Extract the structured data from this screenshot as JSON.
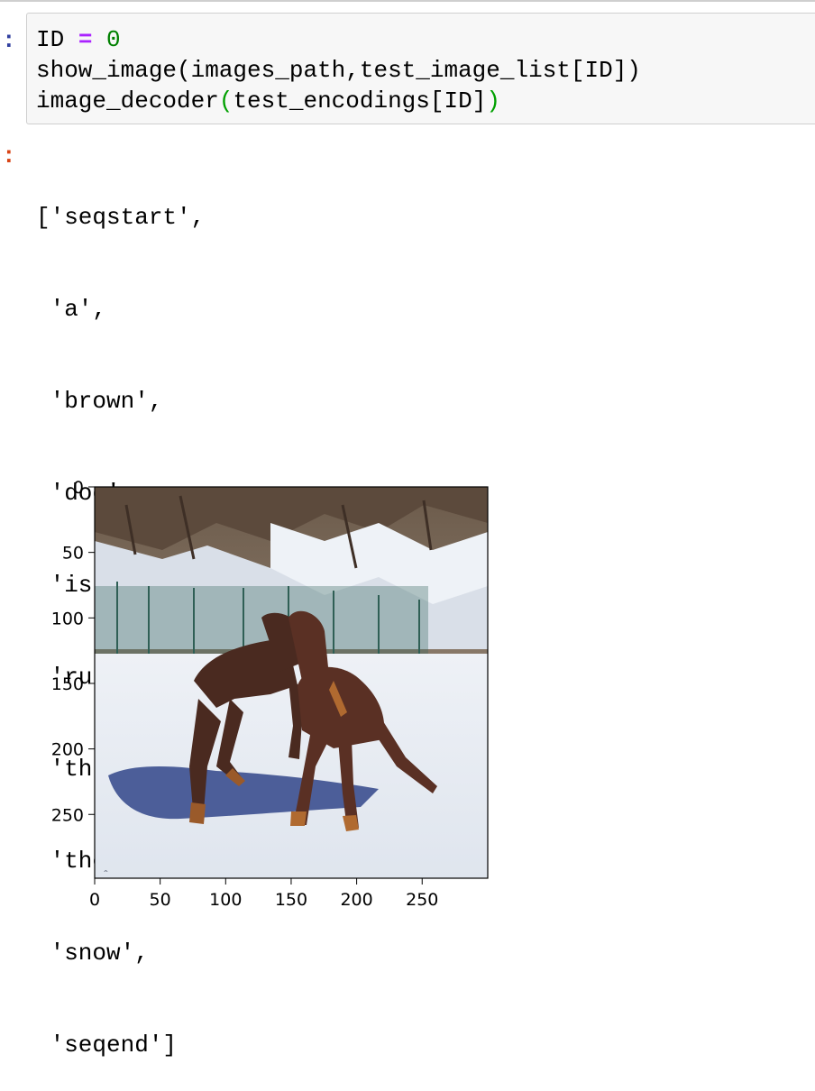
{
  "input_cell": {
    "prompt": ":",
    "lines": [
      [
        {
          "text": "ID ",
          "cls": ""
        },
        {
          "text": "=",
          "cls": "kw-op"
        },
        {
          "text": " ",
          "cls": ""
        },
        {
          "text": "0",
          "cls": "kw-num"
        }
      ],
      [
        {
          "text": "show_image(images_path,test_image_list[ID])",
          "cls": ""
        }
      ],
      [
        {
          "text": "image_decoder",
          "cls": ""
        },
        {
          "text": "(",
          "cls": "kw-paren"
        },
        {
          "text": "test_encodings[ID]",
          "cls": ""
        },
        {
          "text": ")",
          "cls": "kw-paren"
        }
      ]
    ]
  },
  "output_cell": {
    "prompt": ":",
    "lines": [
      "['seqstart',",
      " 'a',",
      " 'brown',",
      " 'dog',",
      " 'is',",
      " 'running',",
      " 'through',",
      " 'the',",
      " 'snow',",
      " 'seqend']"
    ]
  },
  "figure": {
    "y_ticks": [
      "0",
      "50",
      "100",
      "150",
      "200",
      "250"
    ],
    "x_ticks": [
      "0",
      "50",
      "100",
      "150",
      "200",
      "250"
    ],
    "image_subject": "two brown dobermans playing in snow"
  }
}
